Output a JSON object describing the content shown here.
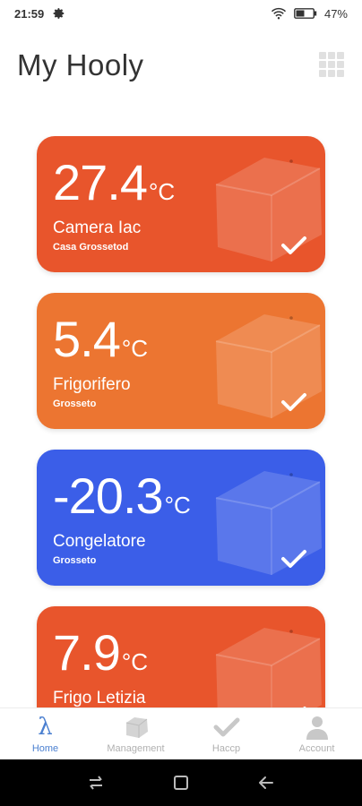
{
  "status_bar": {
    "time": "21:59",
    "battery_pct": "47%"
  },
  "header": {
    "title": "My Hooly"
  },
  "cards": [
    {
      "temp": "27.4",
      "unit": "°C",
      "name": "Camera Iac",
      "location": "Casa Grossetod",
      "color": "#e8552c",
      "status": "ok"
    },
    {
      "temp": "5.4",
      "unit": "°C",
      "name": "Frigorifero",
      "location": "Grosseto",
      "color": "#ec7531",
      "status": "ok"
    },
    {
      "temp": "-20.3",
      "unit": "°C",
      "name": "Congelatore",
      "location": "Grosseto",
      "color": "#3b5ee8",
      "status": "ok"
    },
    {
      "temp": "7.9",
      "unit": "°C",
      "name": "Frigo Letizia",
      "location": "",
      "color": "#e8552c",
      "status": "ok"
    }
  ],
  "bottom_nav": [
    {
      "label": "Home",
      "icon": "lambda-icon",
      "active": true
    },
    {
      "label": "Management",
      "icon": "device-icon",
      "active": false
    },
    {
      "label": "Haccp",
      "icon": "check-icon",
      "active": false
    },
    {
      "label": "Account",
      "icon": "user-icon",
      "active": false
    }
  ],
  "colors": {
    "accent": "#4a7fd0",
    "nav_inactive": "#b0b0b0"
  }
}
